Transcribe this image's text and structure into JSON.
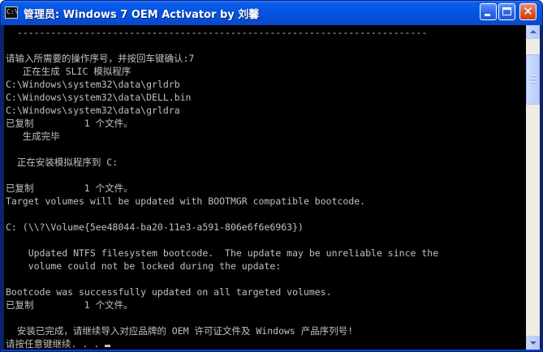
{
  "window": {
    "title": "管理员: Windows 7 OEM Activator by 刘馨",
    "icon_text": "C:\\"
  },
  "console": {
    "lines": [
      "  -------------------------------------------------------------------------",
      "",
      "请输入所需要的操作序号，并按回车键确认:7",
      "   正在生成 SLIC 模拟程序",
      "C:\\Windows\\system32\\data\\grldrb",
      "C:\\Windows\\system32\\data\\DELL.bin",
      "C:\\Windows\\system32\\data\\grldra",
      "已复制         1 个文件。",
      "   生成完毕",
      "",
      "  正在安装模拟程序到 C:",
      "",
      "已复制         1 个文件。",
      "Target volumes will be updated with BOOTMGR compatible bootcode.",
      "",
      "C: (\\\\?\\Volume{5ee48044-ba20-11e3-a591-806e6f6e6963})",
      "",
      "    Updated NTFS filesystem bootcode.  The update may be unreliable since the",
      "    volume could not be locked during the update:",
      "",
      "Bootcode was successfully updated on all targeted volumes.",
      "已复制         1 个文件。",
      "",
      "  安装已完成，请继续导入对应品牌的 OEM 许可证文件及 Windows 产品序列号!",
      "请按任意键继续. . . "
    ]
  }
}
